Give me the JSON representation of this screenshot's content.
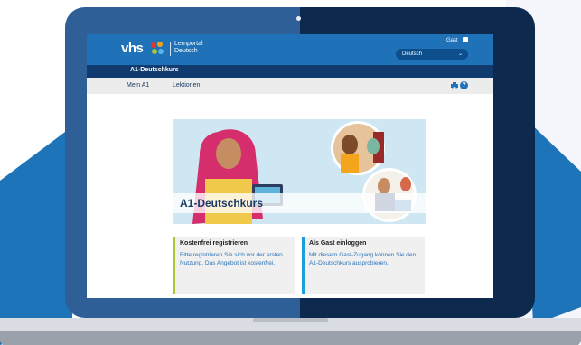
{
  "colors": {
    "primary": "#1f71b8",
    "dark": "#113b6f",
    "accent_green": "#a7c738",
    "accent_blue": "#1f9be0"
  },
  "header": {
    "logo": "vhs",
    "logo_line1": "Lernportal",
    "logo_line2": "Deutsch",
    "guest_label": "Gast",
    "language_value": "Deutsch"
  },
  "course_bar": {
    "title": "A1-Deutschkurs"
  },
  "nav": {
    "items": [
      {
        "label": "Mein A1"
      },
      {
        "label": "Lektionen"
      }
    ]
  },
  "hero": {
    "title": "A1-Deutschkurs"
  },
  "cards": [
    {
      "title": "Kostenfrei registrieren",
      "body": "Bitte registrieren Sie sich vor der ersten Nutzung. Das Angebot ist kostenfrei."
    },
    {
      "title": "Als Gast einloggen",
      "body": "Mit diesem Gast-Zugang können Sie den A1-Deutschkurs ausprobieren."
    }
  ],
  "icons": [
    "lock-icon",
    "chevron-down-icon",
    "print-icon",
    "help-icon",
    "camera-icon"
  ]
}
